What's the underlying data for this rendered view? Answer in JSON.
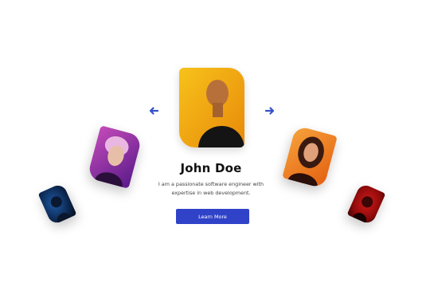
{
  "profile": {
    "name": "John Doe",
    "bio": "I am a passionate software engineer with expertise in web development.",
    "cta_label": "Learn More"
  },
  "carousel": {
    "cards": [
      {
        "id": "blue",
        "gradient": [
          "#0d2a55",
          "#040b18"
        ]
      },
      {
        "id": "purple",
        "gradient": [
          "#5a1b8a",
          "#c34ab9"
        ]
      },
      {
        "id": "main",
        "gradient": [
          "#f7c21a",
          "#e8890a"
        ]
      },
      {
        "id": "orange",
        "gradient": [
          "#f6a23b",
          "#e45f10"
        ]
      },
      {
        "id": "red",
        "gradient": [
          "#8e0a0a",
          "#220404"
        ]
      }
    ],
    "prev_icon": "arrow-left-icon",
    "next_icon": "arrow-right-icon"
  },
  "colors": {
    "accent": "#3042c8",
    "arrow": "#3551c9",
    "text": "#111111"
  }
}
